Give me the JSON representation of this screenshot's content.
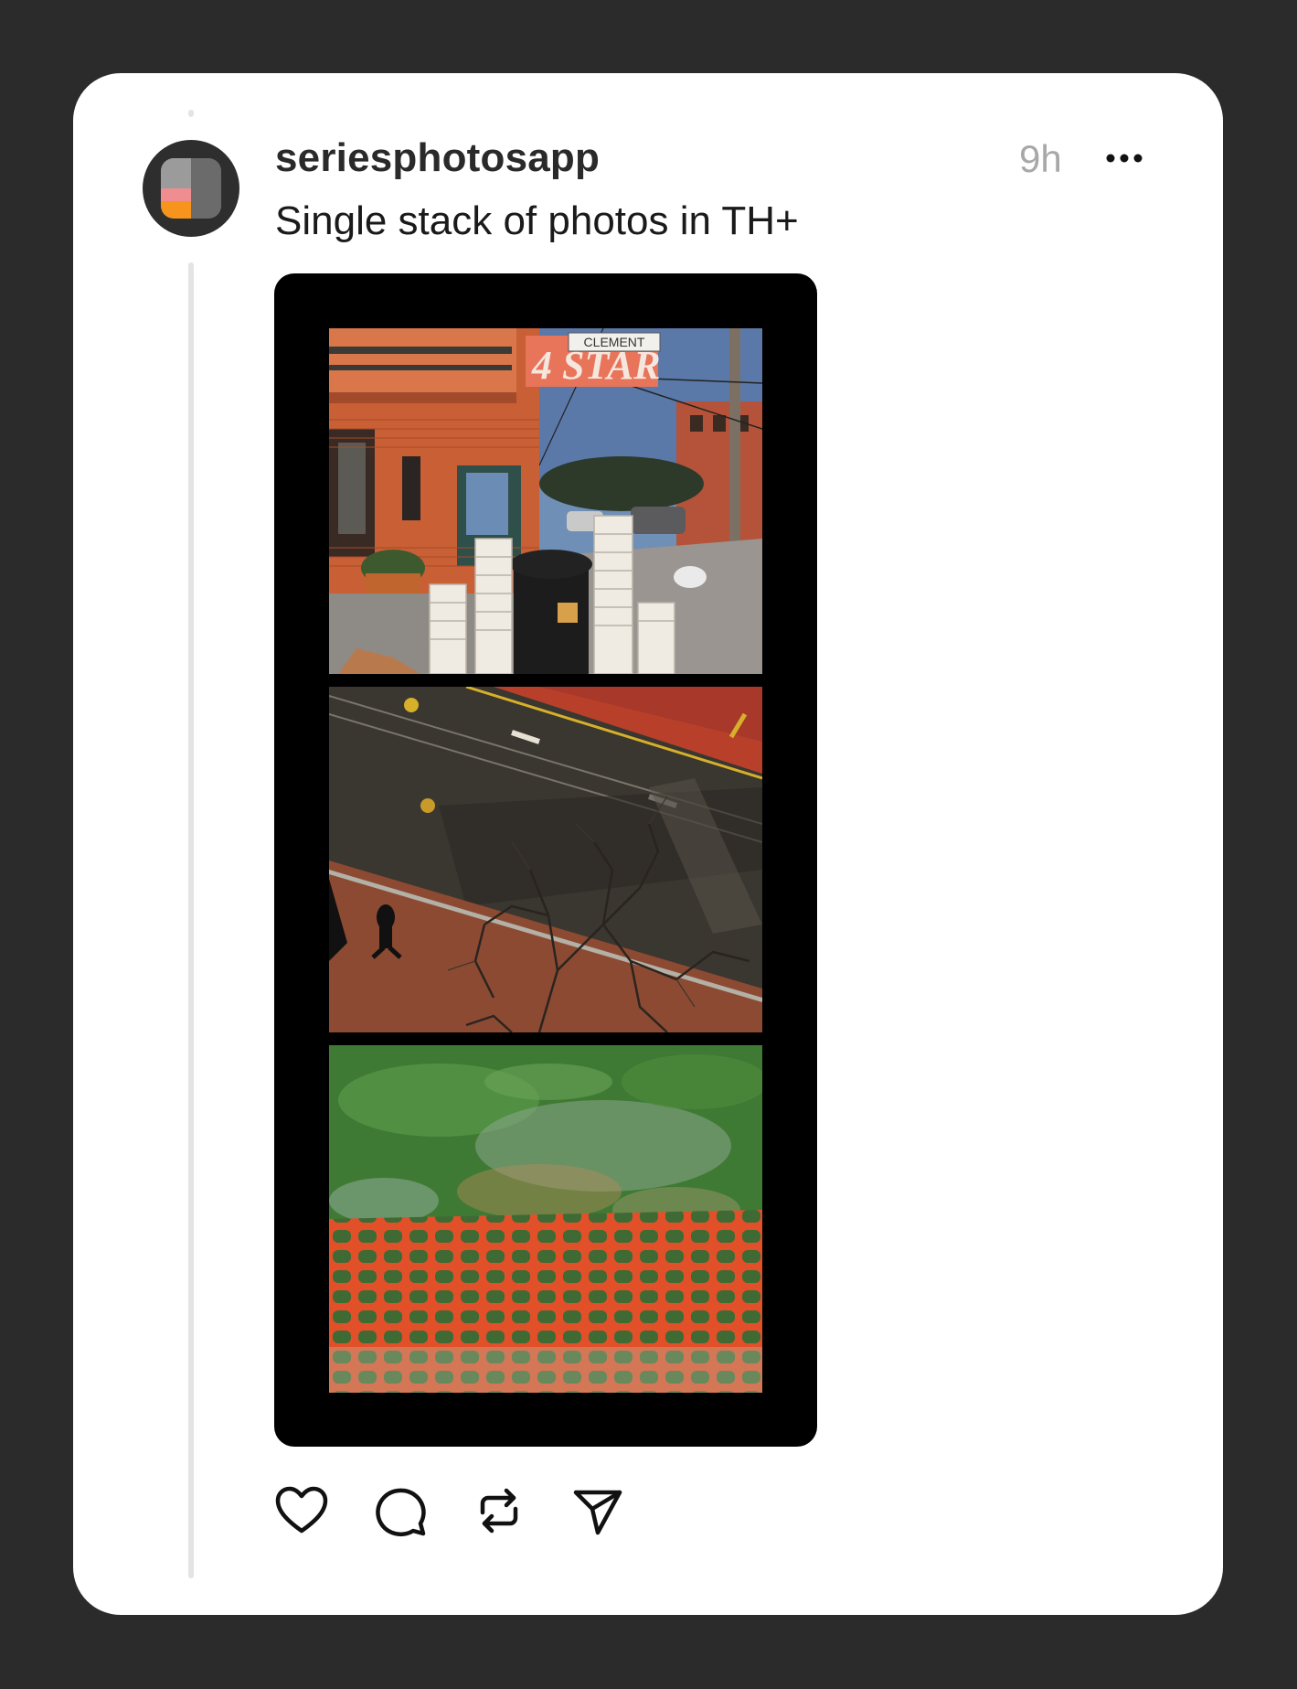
{
  "post": {
    "username": "seriesphotosapp",
    "timestamp": "9h",
    "text": "Single stack of photos in TH+",
    "avatar_icon": "series-app-logo-icon",
    "more_icon": "more-horizontal-icon"
  },
  "photos": [
    {
      "sign_text": "CLEMENT",
      "marquee_text": "4 STAR"
    },
    {},
    {}
  ],
  "actions": [
    {
      "icon": "heart-icon",
      "label": "Like"
    },
    {
      "icon": "comment-icon",
      "label": "Reply"
    },
    {
      "icon": "repost-icon",
      "label": "Repost"
    },
    {
      "icon": "share-icon",
      "label": "Share"
    }
  ],
  "colors": {
    "background": "#2b2b2b",
    "card": "#ffffff",
    "thread_line": "#e4e4e4",
    "timestamp": "#a8a8a8",
    "text": "#1a1a1a"
  }
}
